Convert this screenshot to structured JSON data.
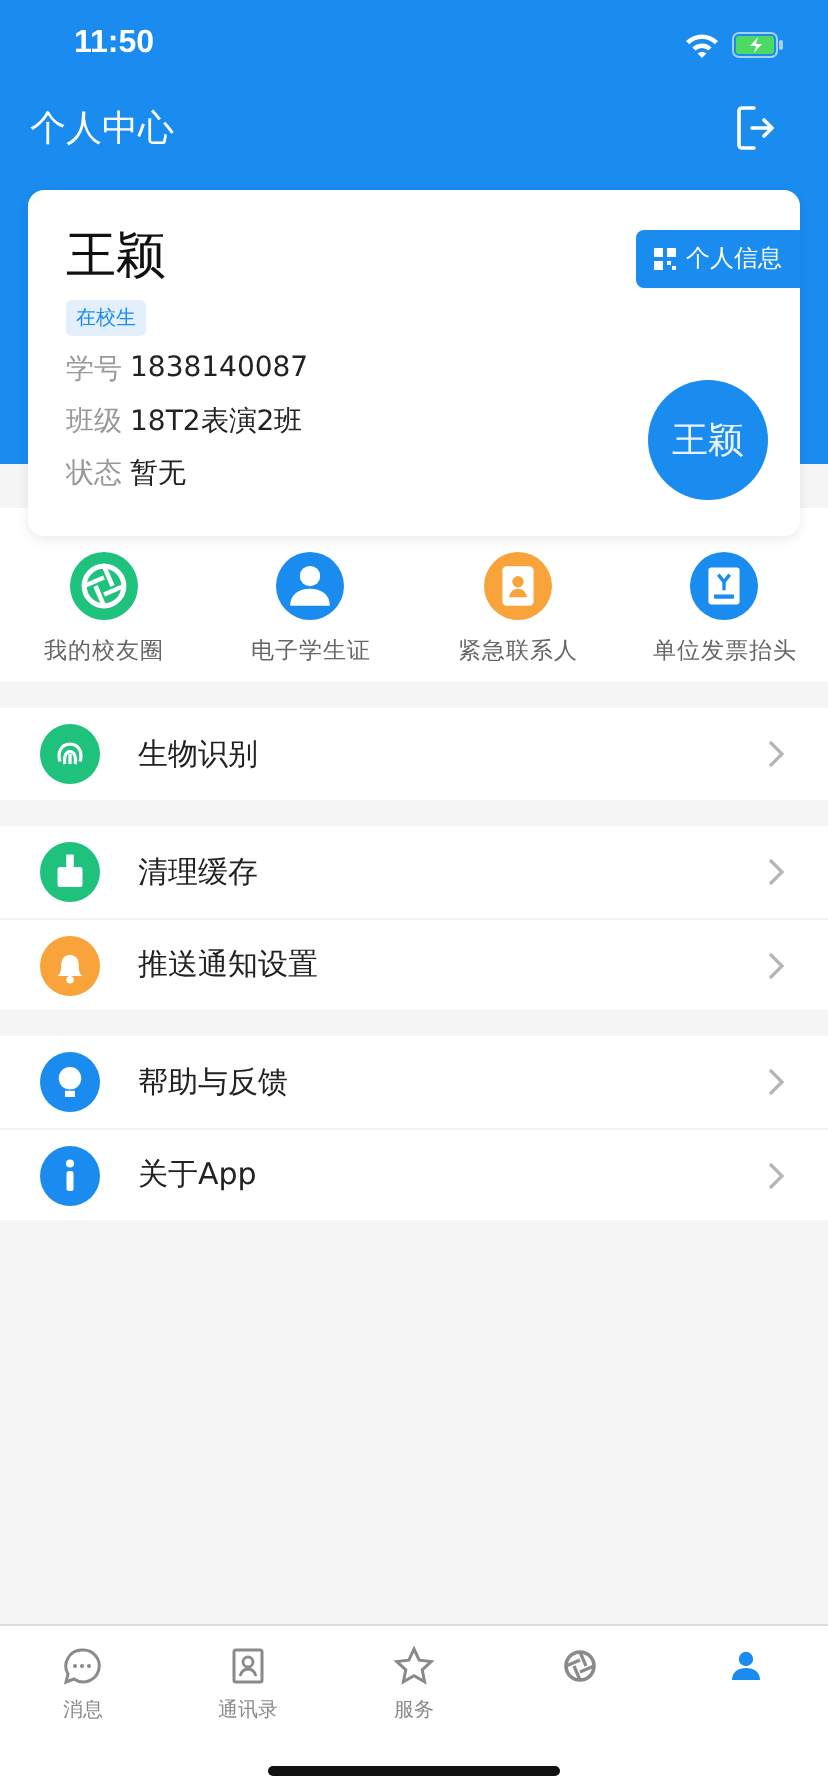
{
  "status_bar": {
    "time": "11:50"
  },
  "header": {
    "title": "个人中心"
  },
  "profile": {
    "name": "王颖",
    "badge": "在校生",
    "info_button": "个人信息",
    "avatar_text": "王颖",
    "fields": [
      {
        "label": "学号",
        "value": "1838140087"
      },
      {
        "label": "班级",
        "value": "18T2表演2班"
      },
      {
        "label": "状态",
        "value": "暂无"
      }
    ]
  },
  "shortcuts": [
    {
      "label": "我的校友圈",
      "kind": "aperture",
      "color": "#1ec27d"
    },
    {
      "label": "电子学生证",
      "kind": "person",
      "color": "#1a8cf0"
    },
    {
      "label": "紧急联系人",
      "kind": "contact",
      "color": "#f8a43a"
    },
    {
      "label": "单位发票抬头",
      "kind": "invoice",
      "color": "#1a8cf0"
    }
  ],
  "menu_groups": [
    [
      {
        "label": "生物识别",
        "kind": "fingerprint",
        "color": "#1ec27d"
      }
    ],
    [
      {
        "label": "清理缓存",
        "kind": "broom",
        "color": "#1ec27d"
      },
      {
        "label": "推送通知设置",
        "kind": "bell",
        "color": "#f8a43a"
      }
    ],
    [
      {
        "label": "帮助与反馈",
        "kind": "bulb",
        "color": "#1a8cf0"
      },
      {
        "label": "关于App",
        "kind": "info",
        "color": "#1a8cf0"
      }
    ]
  ],
  "tab_bar": [
    {
      "label": "消息",
      "kind": "chat",
      "selected": false
    },
    {
      "label": "通讯录",
      "kind": "contacts",
      "selected": false
    },
    {
      "label": "服务",
      "kind": "star",
      "selected": false
    },
    {
      "kind": "aperture",
      "selected": false
    },
    {
      "kind": "person",
      "selected": true
    }
  ]
}
